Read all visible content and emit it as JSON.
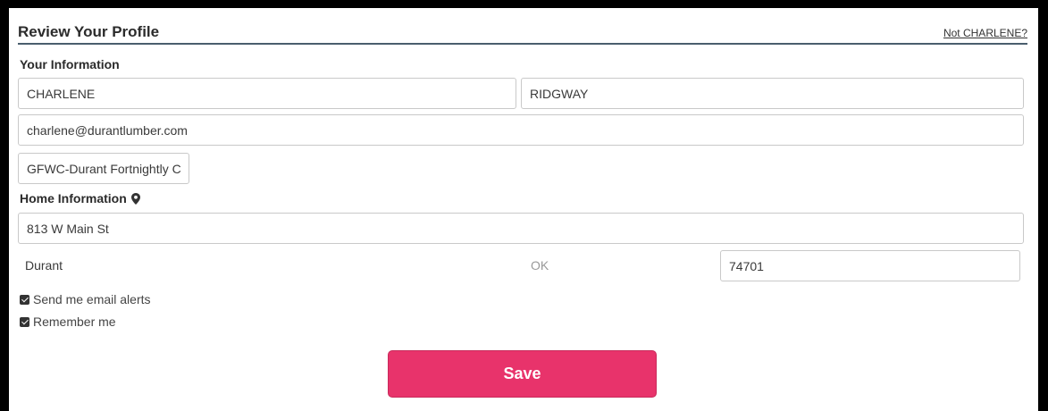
{
  "header": {
    "title": "Review Your Profile",
    "not_user_link": "Not CHARLENE?"
  },
  "your_information": {
    "label": "Your Information",
    "first_name": "CHARLENE",
    "last_name": "RIDGWAY",
    "email": "charlene@durantlumber.com",
    "club": "GFWC-Durant Fortnightly C"
  },
  "home_information": {
    "label": "Home Information",
    "icon": "map-pin-icon",
    "street": "813 W Main St",
    "city": "Durant",
    "state": "OK",
    "zip": "74701"
  },
  "options": {
    "email_alerts_label": "Send me email alerts",
    "email_alerts_checked": true,
    "remember_me_label": "Remember me",
    "remember_me_checked": true
  },
  "actions": {
    "save_label": "Save"
  },
  "colors": {
    "save_button": "#e8336b",
    "header_rule": "#4a5e6d",
    "frame": "#000000"
  }
}
